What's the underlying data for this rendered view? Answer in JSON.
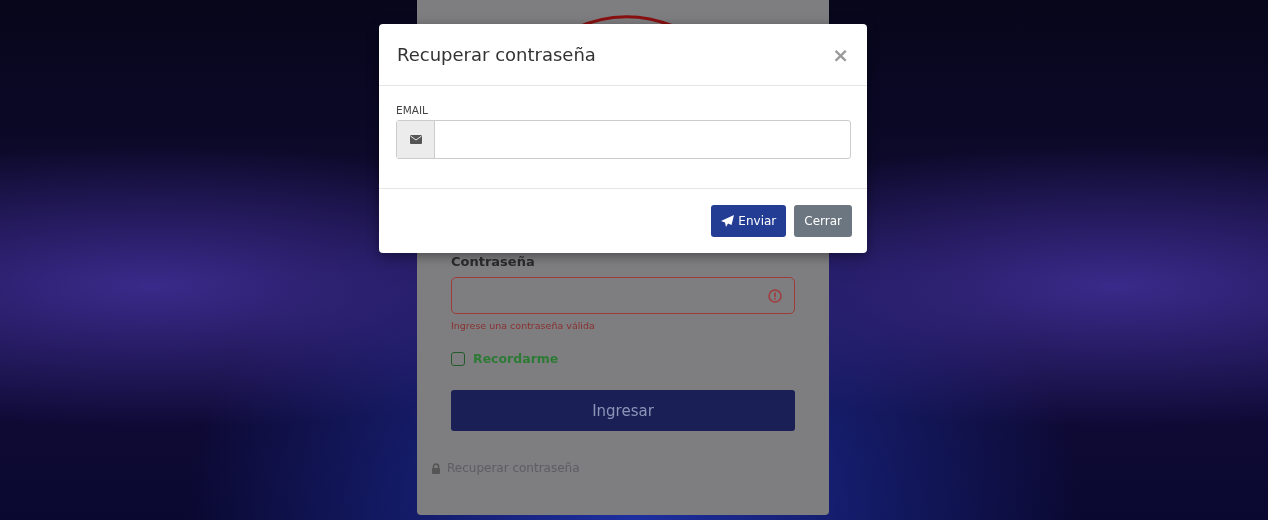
{
  "login": {
    "password_label": "Contraseña",
    "password_invalid": true,
    "password_error": "Ingrese una contraseña válida",
    "remember": {
      "label": "Recordarme",
      "checked": false
    },
    "submit": "Ingresar",
    "recover_link": "Recuperar contraseña"
  },
  "modal": {
    "title": "Recuperar contraseña",
    "close": "×",
    "email_label": "EMAIL",
    "buttons": [
      {
        "label": "Enviar",
        "kind": "primary"
      },
      {
        "label": "Cerrar",
        "kind": "secondary"
      }
    ]
  }
}
